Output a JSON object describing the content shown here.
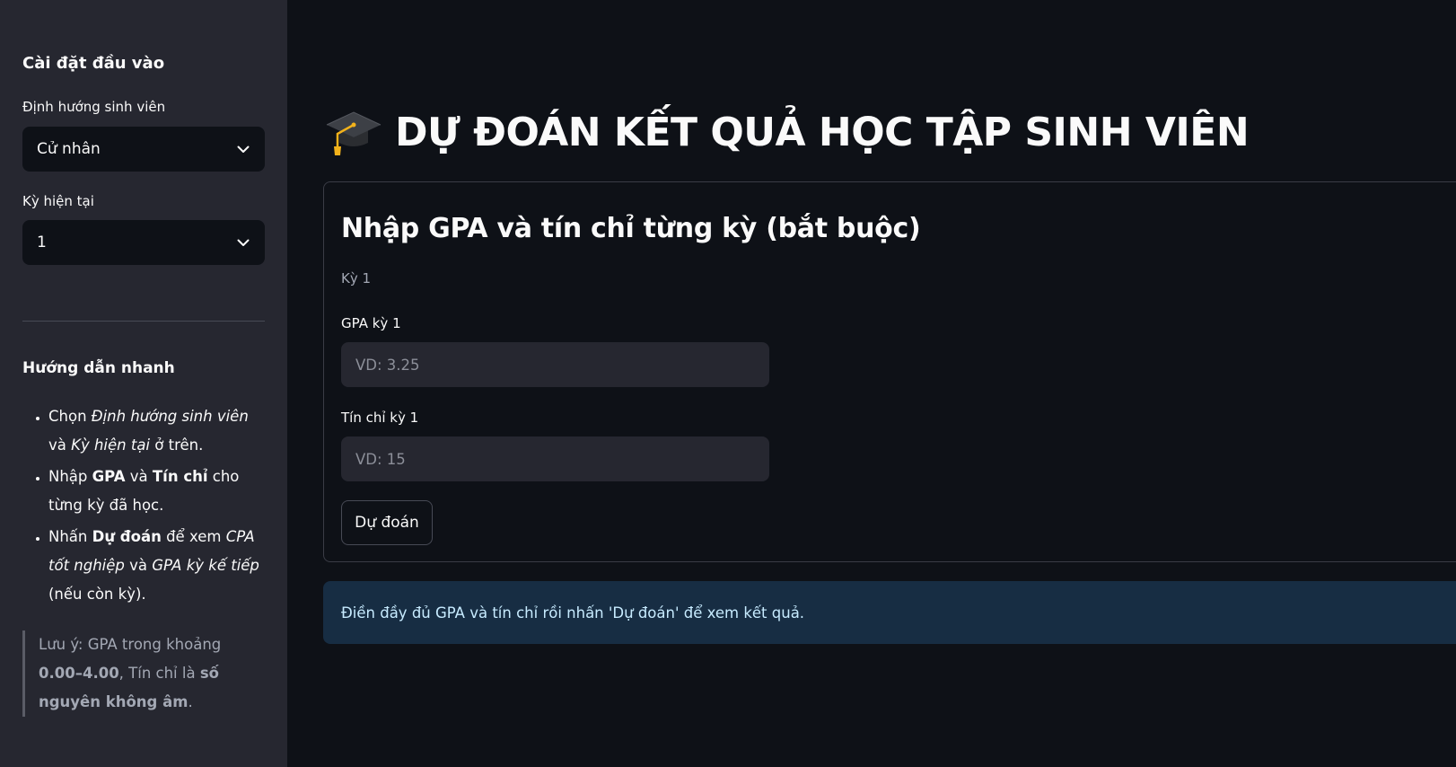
{
  "sidebar": {
    "header": "Cài đặt đầu vào",
    "orientation_label": "Định hướng sinh viên",
    "orientation_value": "Cử nhân",
    "semester_label": "Kỳ hiện tại",
    "semester_value": "1",
    "guide_title": "Hướng dẫn nhanh",
    "guide": {
      "item1": {
        "a": "Chọn ",
        "b": "Định hướng sinh viên",
        "c": " và ",
        "d": "Kỳ hiện tại",
        "e": " ở trên."
      },
      "item2": {
        "a": "Nhập ",
        "b": "GPA",
        "c": " và ",
        "d": "Tín chỉ",
        "e": " cho từng kỳ đã học."
      },
      "item3": {
        "a": "Nhấn ",
        "b": "Dự đoán",
        "c": " để xem ",
        "d": "CPA tốt nghiệp",
        "e": " và ",
        "f": "GPA kỳ kế tiếp",
        "g": " (nếu còn kỳ)."
      }
    },
    "note": {
      "a": "Lưu ý: GPA trong khoảng ",
      "b": "0.00–4.00",
      "c": ", Tín chỉ là ",
      "d": "số nguyên không âm",
      "e": "."
    }
  },
  "main": {
    "title": "DỰ ĐOÁN KẾT QUẢ HỌC TẬP SINH VIÊN",
    "title_icon": "graduation-cap-icon",
    "form_title": "Nhập GPA và tín chỉ từng kỳ (bắt buộc)",
    "semester_caption": "Kỳ 1",
    "gpa_label": "GPA kỳ 1",
    "gpa_placeholder": "VD: 3.25",
    "credits_label": "Tín chỉ kỳ 1",
    "credits_placeholder": "VD: 15",
    "predict_button": "Dự đoán",
    "info_message": "Điền đầy đủ GPA và tín chỉ rồi nhấn 'Dự đoán' để xem kết quả."
  }
}
